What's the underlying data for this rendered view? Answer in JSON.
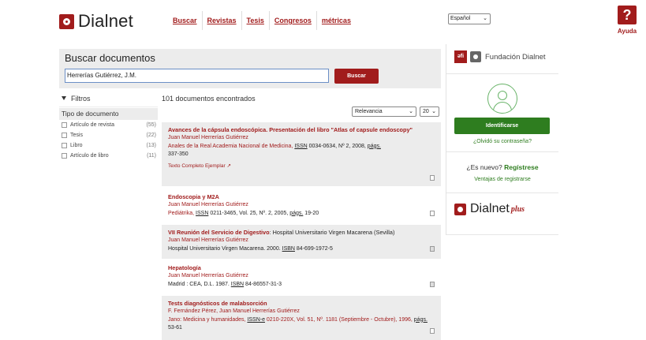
{
  "header": {
    "logo_text": "Dialnet",
    "nav": [
      "Buscar",
      "Revistas",
      "Tesis",
      "Congresos",
      "métricas"
    ],
    "language": "Español",
    "help_label": "Ayuda",
    "help_icon": "?"
  },
  "search": {
    "title": "Buscar documentos",
    "query": "Herrerías Gutiérrez, J.M.",
    "button": "Buscar"
  },
  "filters": {
    "title": "Filtros",
    "section": "Tipo de documento",
    "items": [
      {
        "label": "Artículo de revista",
        "count": "(55)"
      },
      {
        "label": "Tesis",
        "count": "(22)"
      },
      {
        "label": "Libro",
        "count": "(13)"
      },
      {
        "label": "Artículo de libro",
        "count": "(11)"
      }
    ]
  },
  "results": {
    "count_text": "101 documentos encontrados",
    "sort": "Relevancia",
    "per_page": "20",
    "items": [
      {
        "title": "Avances de la cápsula endoscópica. Presentación del libro \"Atlas of capsule endoscopy\"",
        "author": "Juan Manuel Herrerías Gutiérrez",
        "source_a": "Anales de la Real Academia Nacional de Medicina, ",
        "issn_label": "ISSN",
        "source_b": " 0034-0634, Nº 2, 2008, ",
        "pags_label": "págs.",
        "source_c": "337-350",
        "link": "Texto Completo Ejemplar"
      },
      {
        "title": "Endoscopia y M2A",
        "author": "Juan Manuel Herrerías Gutiérrez",
        "source_a": "Pediátrika, ",
        "issn_label": "ISSN",
        "source_b": " 0211-3465, Vol. 25, Nº. 2, 2005, ",
        "pags_label": "págs.",
        "source_c": " 19-20"
      },
      {
        "title": "VII Reunión del Servicio de Digestivo",
        "title_rest": ": Hospital Universitario Virgen Macarena (Sevilla)",
        "author": "Juan Manuel Herrerías Gutiérrez",
        "container": "Hospital Universitario Virgen Macarena. 2000. ",
        "isbn_label": "ISBN",
        "container_b": " 84-699-1972-5"
      },
      {
        "title": "Hepatología",
        "author": "Juan Manuel Herrerías Gutiérrez",
        "container": "Madrid : CEA, D.L. 1987. ",
        "isbn_label": "ISBN",
        "container_b": " 84-86557-31-3"
      },
      {
        "title": "Tests diagnósticos de malabsorción",
        "author": "F. Fernández Pérez, Juan Manuel Herrerías Gutiérrez",
        "source_a": "Jano: Medicina y humanidades, ",
        "issn_label": "ISSN-e",
        "source_b": " 0210-220X, Vol. 51, Nº. 1181 (Septiembre - Octubre), 1996, ",
        "pags_label": "págs.",
        "source_c": " 53-61"
      }
    ]
  },
  "sidebar": {
    "foundation": "Fundación Dialnet",
    "login_button": "Identificarse",
    "forgot": "¿Olvidó su contraseña?",
    "new_q": "¿Es nuevo? ",
    "register": "Regístrese",
    "advantages": "Ventajas de registrarse",
    "plus_logo": "Dialnet",
    "plus_word": "plus"
  },
  "colors": {
    "brand": "#a11c1c",
    "green": "#2e7d1f"
  }
}
